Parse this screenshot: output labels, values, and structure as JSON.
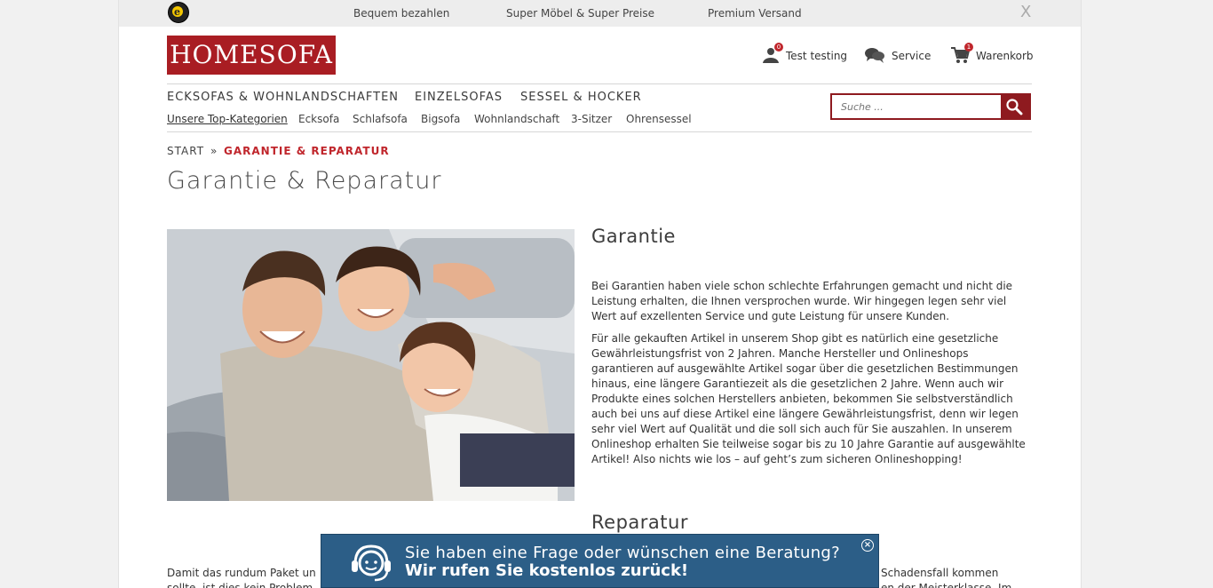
{
  "topbar": {
    "seal_letter": "e",
    "items": [
      "Bequem bezahlen",
      "Super Möbel & Super Preise",
      "Premium Versand"
    ],
    "close": "X"
  },
  "logo": "HOMESOFA",
  "header": {
    "account_label": "Test testing",
    "account_badge": "0",
    "service_label": "Service",
    "cart_label": "Warenkorb",
    "cart_badge": "1"
  },
  "nav": {
    "main": [
      "ECKSOFAS & WOHNLANDSCHAFTEN",
      "EINZELSOFAS",
      "SESSEL & HOCKER"
    ],
    "top_categories_label": "Unsere Top-Kategorien",
    "sub": [
      "Ecksofa",
      "Schlafsofa",
      "Bigsofa",
      "Wohnlandschaft",
      "3-Sitzer",
      "Ohrensessel"
    ]
  },
  "search": {
    "placeholder": "Suche ..."
  },
  "breadcrumb": {
    "start": "START",
    "separator": "»",
    "current": "GARANTIE & REPARATUR"
  },
  "page_title": "Garantie & Reparatur",
  "content": {
    "garantie_heading": "Garantie",
    "garantie_p1": "Bei Garantien haben viele schon schlechte Erfahrungen gemacht und nicht die Leistung erhalten, die Ihnen versprochen wurde. Wir hingegen legen sehr viel Wert auf exzellenten Service und gute Leistung für unsere Kunden.",
    "garantie_p2": "Für alle gekauften Artikel in unserem Shop gibt es natürlich eine gesetzliche Gewährleistungsfrist von 2 Jahren. Manche Hersteller und Onlineshops garantieren auf ausgewählte Artikel sogar über die gesetzlichen Bestimmungen hinaus, eine längere Garantiezeit als die gesetzlichen 2 Jahre. Wenn auch wir Produkte eines solchen Herstellers anbieten, bekommen Sie selbstverständlich auch bei uns auf diese Artikel eine längere Gewährleistungsfrist, denn wir legen sehr viel Wert auf Qualität und die soll sich auch für Sie auszahlen. In unserem Onlineshop erhalten Sie teilweise sogar bis zu 10 Jahre Garantie auf ausgewählte Artikel! Also nichts wie los – auf geht’s zum sicheren Onlineshopping!",
    "reparatur_heading": "Reparatur",
    "bottom_left_1": "Damit das rundum Paket un",
    "bottom_left_2": "sollte, ist dies kein Problem",
    "bottom_right_1": "Schadensfall kommen",
    "bottom_right_2": "en der Meisterklasse. Im"
  },
  "popup": {
    "question": "Sie haben eine Frage oder wünschen eine Beratung?",
    "answer": "Wir rufen Sie kostenlos zurück!",
    "close": "×"
  },
  "colors": {
    "brand_red": "#a91d23",
    "popup_blue": "#2c5e87",
    "breadcrumb_red": "#c0262c"
  }
}
